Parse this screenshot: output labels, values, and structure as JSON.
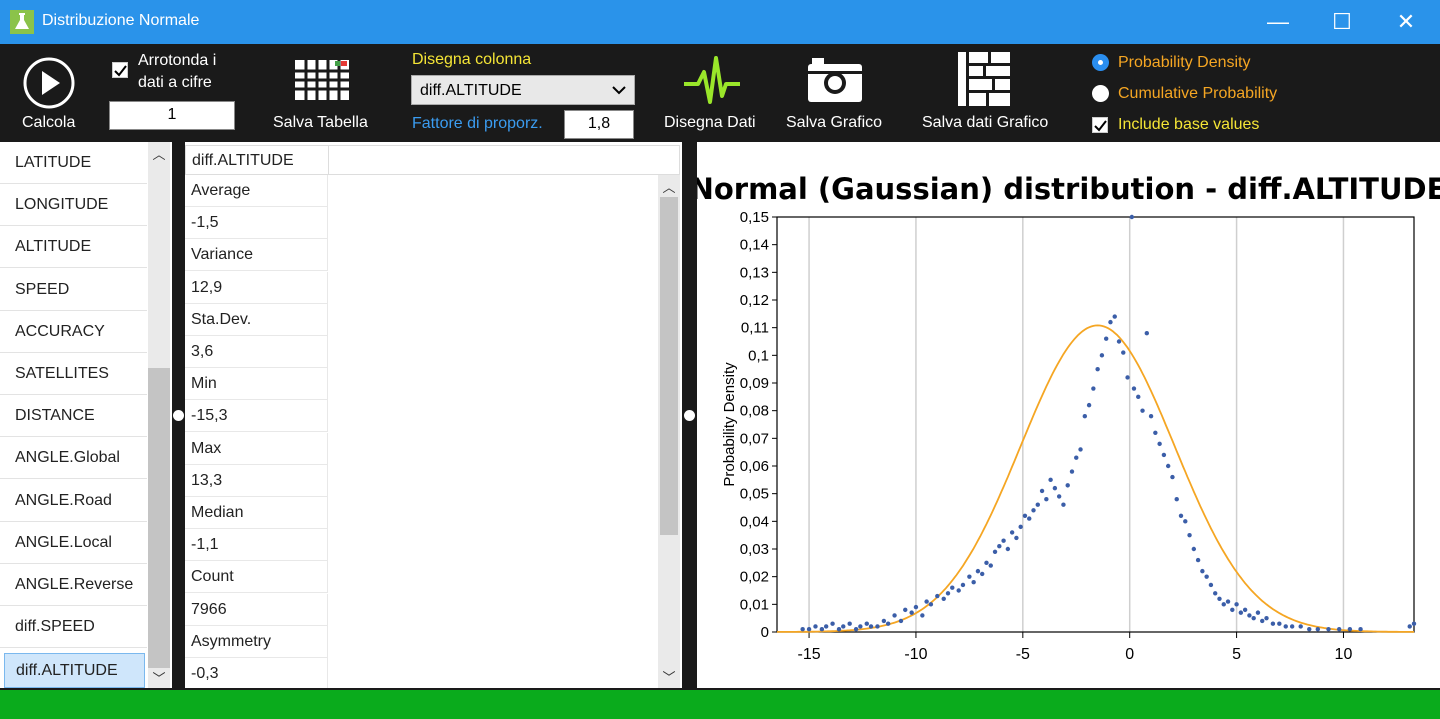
{
  "window": {
    "title": "Distribuzione Normale",
    "minimize": "—",
    "maximize": "☐",
    "close": "✕"
  },
  "toolbar": {
    "calcola_label": "Calcola",
    "arrotonda_label_1": "Arrotonda i",
    "arrotonda_label_2": "dati a cifre",
    "arrotonda_checked": true,
    "digits_value": "1",
    "salva_tabella_label": "Salva Tabella",
    "disegna_colonna_label": "Disegna colonna",
    "column_selected": "diff.ALTITUDE",
    "fattore_label": "Fattore di proporz.",
    "fattore_value": "1,8",
    "disegna_dati_label": "Disegna Dati",
    "salva_grafico_label": "Salva Grafico",
    "salva_dati_grafico_label": "Salva dati Grafico",
    "radio_pd_label": "Probability Density",
    "radio_cp_label": "Cumulative Probability",
    "include_base_label": "Include base values",
    "selected_mode": "Probability Density",
    "include_base_checked": true
  },
  "columns": [
    "LATITUDE",
    "LONGITUDE",
    "ALTITUDE",
    "SPEED",
    "ACCURACY",
    "SATELLITES",
    "DISTANCE",
    "ANGLE.Global",
    "ANGLE.Road",
    "ANGLE.Local",
    "ANGLE.Reverse",
    "diff.SPEED",
    "diff.ALTITUDE"
  ],
  "selected_column": "diff.ALTITUDE",
  "stats": {
    "header": "diff.ALTITUDE",
    "rows": [
      "Average",
      "-1,5",
      "Variance",
      "12,9",
      "Sta.Dev.",
      "3,6",
      "Min",
      "-15,3",
      "Max",
      "13,3",
      "Median",
      "-1,1",
      "Count",
      "7966",
      "Asymmetry",
      "-0,3"
    ]
  },
  "chart_data": {
    "type": "scatter",
    "title": "Normal (Gaussian) distribution - diff.ALTITUDE",
    "xlabel": "",
    "ylabel": "Probability Density",
    "xlim": [
      -16.5,
      13.3
    ],
    "ylim": [
      0,
      0.15
    ],
    "xticks": [
      -15,
      -10,
      -5,
      0,
      5,
      10
    ],
    "yticks": [
      "0",
      "0,01",
      "0,02",
      "0,03",
      "0,04",
      "0,05",
      "0,06",
      "0,07",
      "0,08",
      "0,09",
      "0,1",
      "0,11",
      "0,12",
      "0,13",
      "0,14",
      "0,15"
    ],
    "grid": true,
    "series": [
      {
        "type": "scatter",
        "color": "#3b5ea8",
        "points": [
          [
            -15.3,
            0.001
          ],
          [
            -15.0,
            0.001
          ],
          [
            -14.7,
            0.002
          ],
          [
            -14.4,
            0.001
          ],
          [
            -14.2,
            0.002
          ],
          [
            -13.9,
            0.003
          ],
          [
            -13.6,
            0.001
          ],
          [
            -13.4,
            0.002
          ],
          [
            -13.1,
            0.003
          ],
          [
            -12.8,
            0.001
          ],
          [
            -12.6,
            0.002
          ],
          [
            -12.3,
            0.003
          ],
          [
            -12.1,
            0.002
          ],
          [
            -11.8,
            0.002
          ],
          [
            -11.5,
            0.004
          ],
          [
            -11.3,
            0.003
          ],
          [
            -11.0,
            0.006
          ],
          [
            -10.7,
            0.004
          ],
          [
            -10.5,
            0.008
          ],
          [
            -10.2,
            0.007
          ],
          [
            -10.0,
            0.009
          ],
          [
            -9.7,
            0.006
          ],
          [
            -9.5,
            0.011
          ],
          [
            -9.3,
            0.01
          ],
          [
            -9.0,
            0.013
          ],
          [
            -8.7,
            0.012
          ],
          [
            -8.5,
            0.014
          ],
          [
            -8.3,
            0.016
          ],
          [
            -8.0,
            0.015
          ],
          [
            -7.8,
            0.017
          ],
          [
            -7.5,
            0.02
          ],
          [
            -7.3,
            0.018
          ],
          [
            -7.1,
            0.022
          ],
          [
            -6.9,
            0.021
          ],
          [
            -6.7,
            0.025
          ],
          [
            -6.5,
            0.024
          ],
          [
            -6.3,
            0.029
          ],
          [
            -6.1,
            0.031
          ],
          [
            -5.9,
            0.033
          ],
          [
            -5.7,
            0.03
          ],
          [
            -5.5,
            0.036
          ],
          [
            -5.3,
            0.034
          ],
          [
            -5.1,
            0.038
          ],
          [
            -4.9,
            0.042
          ],
          [
            -4.7,
            0.041
          ],
          [
            -4.5,
            0.044
          ],
          [
            -4.3,
            0.046
          ],
          [
            -4.1,
            0.051
          ],
          [
            -3.9,
            0.048
          ],
          [
            -3.7,
            0.055
          ],
          [
            -3.5,
            0.052
          ],
          [
            -3.3,
            0.049
          ],
          [
            -3.1,
            0.046
          ],
          [
            -2.9,
            0.053
          ],
          [
            -2.7,
            0.058
          ],
          [
            -2.5,
            0.063
          ],
          [
            -2.3,
            0.066
          ],
          [
            -2.1,
            0.078
          ],
          [
            -1.9,
            0.082
          ],
          [
            -1.7,
            0.088
          ],
          [
            -1.5,
            0.095
          ],
          [
            -1.3,
            0.1
          ],
          [
            -1.1,
            0.106
          ],
          [
            -0.9,
            0.112
          ],
          [
            -0.7,
            0.114
          ],
          [
            -0.5,
            0.105
          ],
          [
            -0.3,
            0.101
          ],
          [
            -0.1,
            0.092
          ],
          [
            0.1,
            0.15
          ],
          [
            0.2,
            0.088
          ],
          [
            0.4,
            0.085
          ],
          [
            0.6,
            0.08
          ],
          [
            0.8,
            0.108
          ],
          [
            1.0,
            0.078
          ],
          [
            1.2,
            0.072
          ],
          [
            1.4,
            0.068
          ],
          [
            1.6,
            0.064
          ],
          [
            1.8,
            0.06
          ],
          [
            2.0,
            0.056
          ],
          [
            2.2,
            0.048
          ],
          [
            2.4,
            0.042
          ],
          [
            2.6,
            0.04
          ],
          [
            2.8,
            0.035
          ],
          [
            3.0,
            0.03
          ],
          [
            3.2,
            0.026
          ],
          [
            3.4,
            0.022
          ],
          [
            3.6,
            0.02
          ],
          [
            3.8,
            0.017
          ],
          [
            4.0,
            0.014
          ],
          [
            4.2,
            0.012
          ],
          [
            4.4,
            0.01
          ],
          [
            4.6,
            0.011
          ],
          [
            4.8,
            0.008
          ],
          [
            5.0,
            0.01
          ],
          [
            5.2,
            0.007
          ],
          [
            5.4,
            0.008
          ],
          [
            5.6,
            0.006
          ],
          [
            5.8,
            0.005
          ],
          [
            6.0,
            0.007
          ],
          [
            6.2,
            0.004
          ],
          [
            6.4,
            0.005
          ],
          [
            6.7,
            0.003
          ],
          [
            7.0,
            0.003
          ],
          [
            7.3,
            0.002
          ],
          [
            7.6,
            0.002
          ],
          [
            8.0,
            0.002
          ],
          [
            8.4,
            0.001
          ],
          [
            8.8,
            0.001
          ],
          [
            9.3,
            0.001
          ],
          [
            9.8,
            0.001
          ],
          [
            10.3,
            0.001
          ],
          [
            10.8,
            0.001
          ],
          [
            13.1,
            0.002
          ],
          [
            13.3,
            0.003
          ]
        ]
      },
      {
        "type": "line",
        "color": "#f5a623",
        "mean": -1.5,
        "sd": 3.6
      }
    ]
  }
}
